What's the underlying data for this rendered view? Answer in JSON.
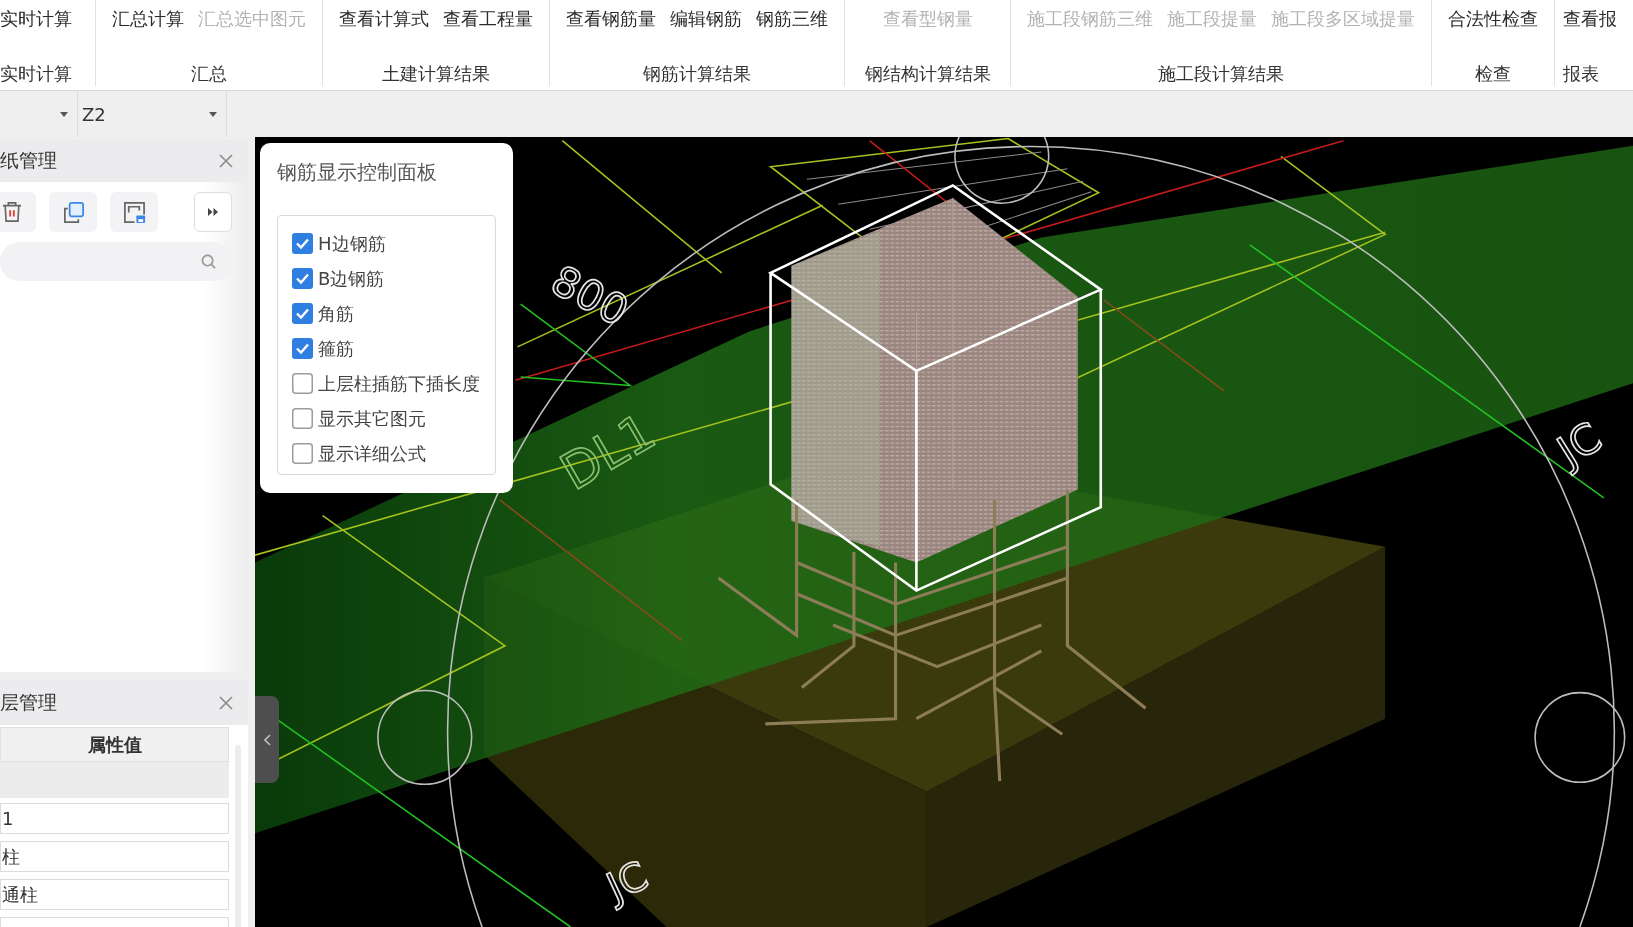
{
  "ribbon": {
    "groups": [
      {
        "label": "实时计算",
        "buttons": [
          {
            "label": "实时计算",
            "disabled": false
          }
        ]
      },
      {
        "label": "汇总",
        "buttons": [
          {
            "label": "汇总计算",
            "disabled": false
          },
          {
            "label": "汇总选中图元",
            "disabled": true
          }
        ]
      },
      {
        "label": "土建计算结果",
        "buttons": [
          {
            "label": "查看计算式",
            "disabled": false
          },
          {
            "label": "查看工程量",
            "disabled": false
          }
        ]
      },
      {
        "label": "钢筋计算结果",
        "buttons": [
          {
            "label": "查看钢筋量",
            "disabled": false
          },
          {
            "label": "编辑钢筋",
            "disabled": false
          },
          {
            "label": "钢筋三维",
            "disabled": false
          }
        ]
      },
      {
        "label": "钢结构计算结果",
        "buttons": [
          {
            "label": "查看型钢量",
            "disabled": true
          }
        ]
      },
      {
        "label": "施工段计算结果",
        "buttons": [
          {
            "label": "施工段钢筋三维",
            "disabled": true
          },
          {
            "label": "施工段提量",
            "disabled": true
          },
          {
            "label": "施工段多区域提量",
            "disabled": true
          }
        ]
      },
      {
        "label": "检查",
        "buttons": [
          {
            "label": "合法性检查",
            "disabled": false
          }
        ]
      },
      {
        "label": "报表",
        "buttons": [
          {
            "label": "查看报",
            "disabled": false
          }
        ]
      }
    ]
  },
  "toolbar": {
    "selectors": [
      {
        "kind": "select"
      },
      {
        "kind": "select",
        "value": "Z2"
      }
    ]
  },
  "drawing_panel": {
    "title": "纸管理"
  },
  "layer_panel": {
    "title": "层管理",
    "columns": [
      "属性值"
    ],
    "rows": [
      {
        "kind": "group"
      },
      {
        "kind": "field",
        "value": "1"
      },
      {
        "kind": "field",
        "value": "柱"
      },
      {
        "kind": "field",
        "value": "通柱"
      },
      {
        "kind": "field"
      }
    ]
  },
  "rebar_panel": {
    "title": "钢筋显示控制面板",
    "options": [
      {
        "label": "H边钢筋",
        "checked": true
      },
      {
        "label": "B边钢筋",
        "checked": true
      },
      {
        "label": "角筋",
        "checked": true
      },
      {
        "label": "箍筋",
        "checked": true
      },
      {
        "label": "上层柱插筋下插长度",
        "checked": false
      },
      {
        "label": "显示其它图元",
        "checked": false
      },
      {
        "label": "显示详细公式",
        "checked": false
      }
    ]
  },
  "viewport": {
    "labels": [
      {
        "text": "800"
      },
      {
        "text": "DL1"
      },
      {
        "text": "JC"
      },
      {
        "text": "JC"
      }
    ]
  }
}
